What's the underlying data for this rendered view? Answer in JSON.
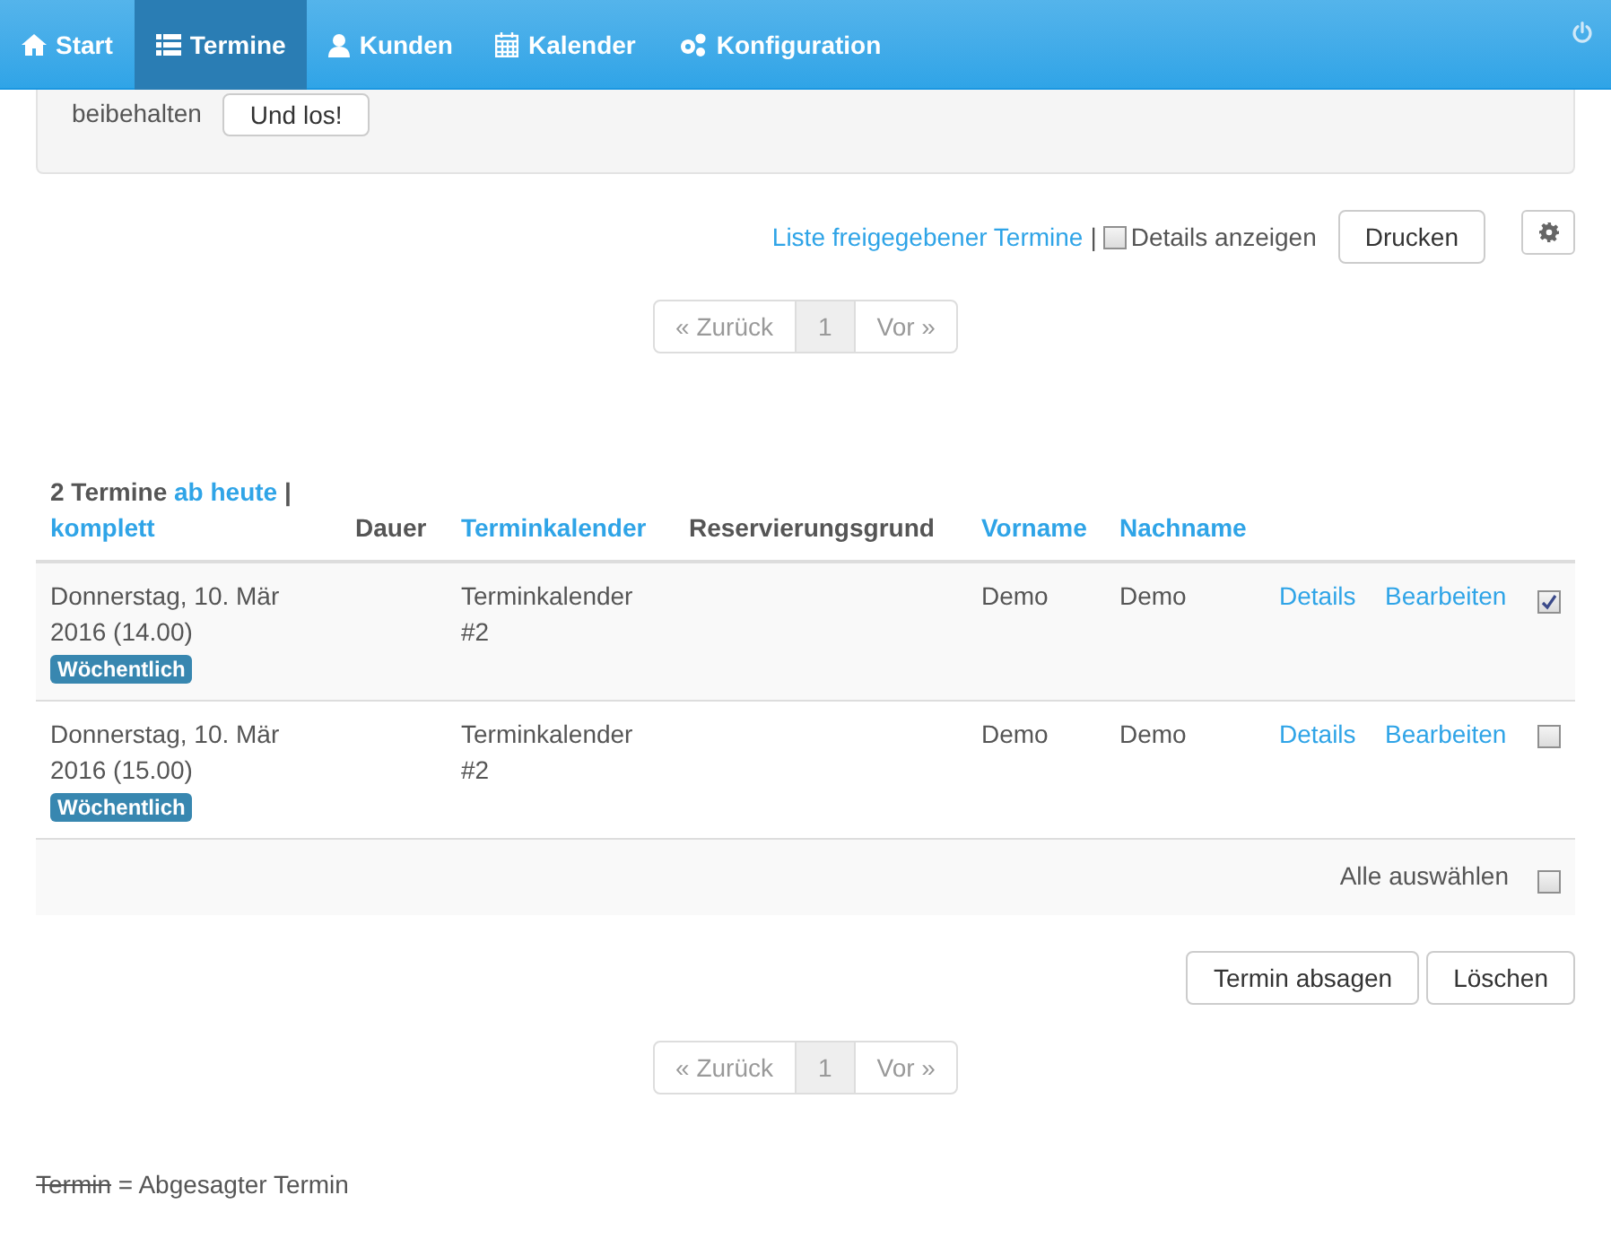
{
  "navbar": {
    "items": [
      {
        "label": "Start",
        "selected": false
      },
      {
        "label": "Termine",
        "selected": true
      },
      {
        "label": "Kunden",
        "selected": false
      },
      {
        "label": "Kalender",
        "selected": false
      },
      {
        "label": "Konfiguration",
        "selected": false
      }
    ]
  },
  "filter_panel": {
    "label": "beibehalten",
    "button": "Und los!"
  },
  "toolbar": {
    "link": "Liste freigegebener Termine",
    "separator": "|",
    "details_checkbox": {
      "label": "Details anzeigen",
      "checked": false
    },
    "print_button": "Drucken"
  },
  "pagination_top": {
    "prev": "« Zurück",
    "pages": [
      {
        "label": "1",
        "selected": true
      }
    ],
    "next": "Vor »"
  },
  "table": {
    "header": {
      "count": "2 Termine",
      "link_today": "ab heute",
      "separator": "|",
      "link_all": "komplett"
    },
    "columns": [
      {
        "label": "Dauer",
        "sortable": false
      },
      {
        "label": "Terminkalender",
        "sortable": true
      },
      {
        "label": "Reservierungsgrund",
        "sortable": false
      },
      {
        "label": "Vorname",
        "sortable": true
      },
      {
        "label": "Nachname",
        "sortable": true
      }
    ],
    "rows": [
      {
        "date": "Donnerstag, 10. Mär 2016 (14.00)",
        "badge": "Wöchentlich",
        "calendar": "Terminkalender #2",
        "first_name": "Demo",
        "last_name": "Demo",
        "actions": [
          "Details",
          "Bearbeiten"
        ],
        "checked": true
      },
      {
        "date": "Donnerstag, 10. Mär 2016 (15.00)",
        "badge": "Wöchentlich",
        "calendar": "Terminkalender #2",
        "first_name": "Demo",
        "last_name": "Demo",
        "actions": [
          "Details",
          "Bearbeiten"
        ],
        "checked": false
      }
    ],
    "footer": {
      "label": "Alle auswählen",
      "checked": false
    }
  },
  "actions": [
    "Termin absagen",
    "Löschen"
  ],
  "pagination_bottom": {
    "prev": "« Zurück",
    "pages": [
      {
        "label": "1",
        "selected": true
      }
    ],
    "next": "Vor »"
  },
  "legend": {
    "example": "Termin",
    "text": "= Abgesagter Termin"
  }
}
